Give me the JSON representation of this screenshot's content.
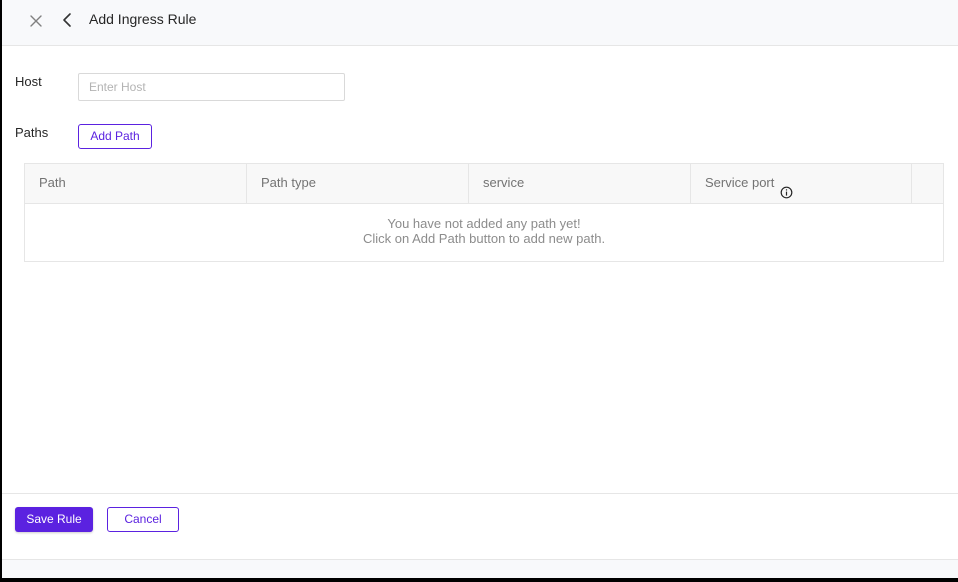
{
  "header": {
    "title": "Add Ingress Rule",
    "close_icon": "close-icon",
    "back_icon": "chevron-left-icon"
  },
  "form": {
    "host_label": "Host",
    "host_placeholder": "Enter Host",
    "host_value": "",
    "paths_label": "Paths",
    "add_path_label": "Add Path"
  },
  "table": {
    "columns": [
      "Path",
      "Path type",
      "service",
      "Service port",
      ""
    ],
    "service_port_info_icon": "info-icon",
    "empty_line1": "You have not added any path yet!",
    "empty_line2": "Click on Add Path button to add new path."
  },
  "footer": {
    "save_label": "Save Rule",
    "cancel_label": "Cancel"
  },
  "colors": {
    "accent": "#5b22e0",
    "header_bg": "#f8f9fb",
    "border": "#e6e6e6"
  }
}
